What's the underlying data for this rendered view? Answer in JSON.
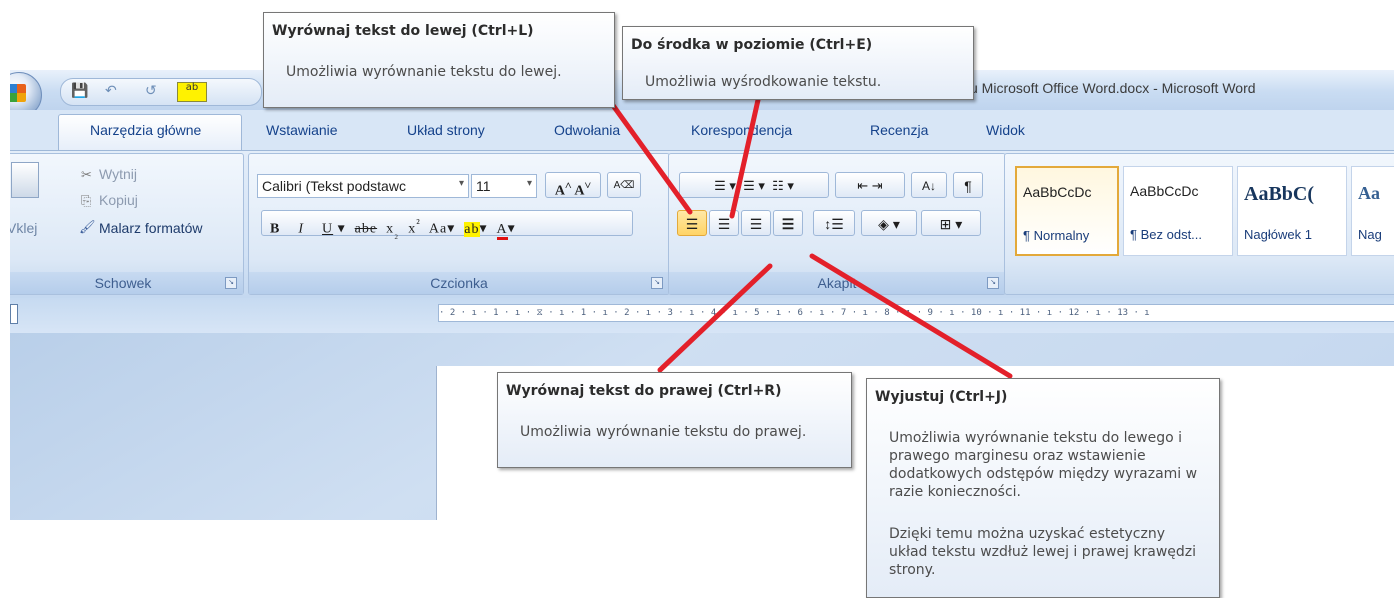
{
  "window": {
    "title": "u Microsoft Office Word.docx - Microsoft Word",
    "qat": {
      "save_icon": "💾",
      "undo_icon": "↶",
      "redo_icon": "↺"
    }
  },
  "tabs": [
    "Narzędzia główne",
    "Wstawianie",
    "Układ strony",
    "Odwołania",
    "Korespondencja",
    "Recenzja",
    "Widok"
  ],
  "ribbon": {
    "clipboard": {
      "label": "Schowek",
      "paste": "Vklej",
      "cut": "Wytnij",
      "copy": "Kopiuj",
      "format_painter": "Malarz formatów"
    },
    "font": {
      "label": "Czcionka",
      "font_name": "Calibri (Tekst podstawc",
      "font_size": "11"
    },
    "paragraph": {
      "label": "Akapit"
    },
    "styles": [
      {
        "sample": "AaBbCcDc",
        "name": "¶ Normalny"
      },
      {
        "sample": "AaBbCcDc",
        "name": "¶ Bez odst..."
      },
      {
        "sample": "AaBbC(",
        "name": "Nagłówek 1"
      },
      {
        "sample": "Aa",
        "name": "Nag"
      }
    ]
  },
  "ruler_text": "· 2 · ı · 1 · ı ·  ⧖ · ı · 1 · ı · 2 · ı · 3 · ı · 4 · ı · 5 · ı · 6 · ı · 7 · ı · 8 · ı · 9 · ı · 10 · ı · 11 · ı · 12 · ı · 13 · ı",
  "tooltips": {
    "left": {
      "title": "Wyrównaj tekst do lewej (Ctrl+L)",
      "body": "Umożliwia wyrównanie tekstu do lewej."
    },
    "center": {
      "title": "Do środka w poziomie (Ctrl+E)",
      "body": "Umożliwia wyśrodkowanie tekstu."
    },
    "right": {
      "title": "Wyrównaj tekst do prawej (Ctrl+R)",
      "body": "Umożliwia wyrównanie tekstu do prawej."
    },
    "justify": {
      "title": "Wyjustuj (Ctrl+J)",
      "body1": "Umożliwia wyrównanie tekstu do lewego i prawego marginesu oraz wstawienie dodatkowych odstępów między wyrazami w razie konieczności.",
      "body2": "Dzięki temu można uzyskać estetyczny układ tekstu wzdłuż lewej i prawej krawędzi strony."
    }
  },
  "colors": {
    "annotation_line": "#e3202a",
    "accent": "#15428b"
  }
}
